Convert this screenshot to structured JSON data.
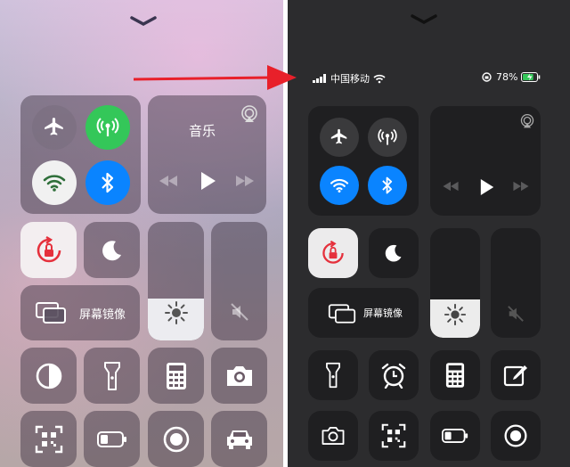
{
  "status_bar": {
    "carrier": "中国移动",
    "battery_percent": "78%",
    "signal_bars": 4,
    "battery_level": 0.78
  },
  "left_panel": {
    "music_title": "音乐",
    "screen_mirroring_label": "屏幕镜像",
    "brightness_level": 0.35,
    "connectivity": {
      "airplane": false,
      "cellular": true,
      "wifi": true,
      "bluetooth": true
    },
    "icons_row4": [
      "dark-mode-icon",
      "flashlight-icon",
      "calculator-icon",
      "camera-icon"
    ],
    "icons_row5": [
      "qr-scanner-icon",
      "low-power-icon",
      "screen-record-icon",
      "car-icon"
    ]
  },
  "right_panel": {
    "screen_mirroring_label": "屏幕镜像",
    "brightness_level": 0.35,
    "connectivity": {
      "airplane": false,
      "cellular": false,
      "wifi": true,
      "bluetooth": true
    },
    "icons_row4": [
      "flashlight-icon",
      "alarm-icon",
      "calculator-icon",
      "notes-icon"
    ],
    "icons_row5": [
      "camera-icon",
      "qr-scanner-icon",
      "low-power-icon",
      "screen-record-icon"
    ]
  },
  "colors": {
    "active_green": "#34c759",
    "active_blue": "#0a84ff",
    "arrow_red": "#e8202a",
    "dark_tile": "#1f1f21"
  }
}
